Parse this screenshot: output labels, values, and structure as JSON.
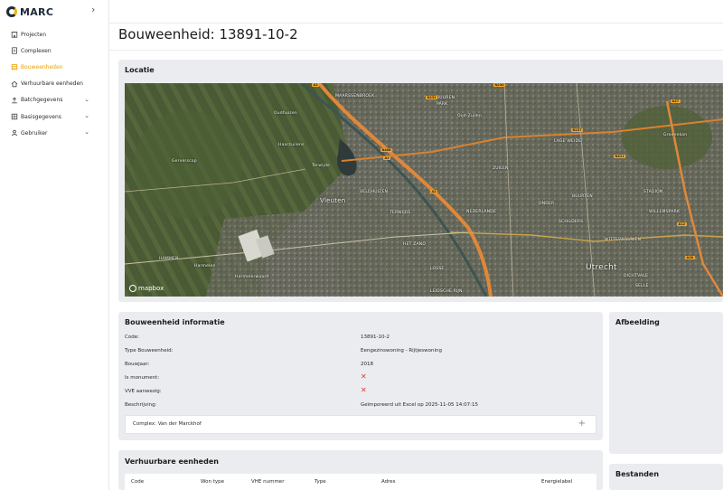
{
  "brand": {
    "name": "MARC",
    "collapse_icon": "chevron-right-icon"
  },
  "sidebar": {
    "items": [
      {
        "label": "Projecten",
        "icon": "building-icon",
        "expandable": false,
        "active": false
      },
      {
        "label": "Complexen",
        "icon": "document-icon",
        "expandable": false,
        "active": false
      },
      {
        "label": "Bouweenheden",
        "icon": "stack-icon",
        "expandable": false,
        "active": true
      },
      {
        "label": "Verhuurbare eenheden",
        "icon": "home-icon",
        "expandable": false,
        "active": false
      },
      {
        "label": "Batchgegevens",
        "icon": "upload-icon",
        "expandable": true,
        "active": false
      },
      {
        "label": "Basisgegevens",
        "icon": "grid-icon",
        "expandable": true,
        "active": false
      },
      {
        "label": "Gebruiker",
        "icon": "user-icon",
        "expandable": true,
        "active": false
      }
    ],
    "active_color": "#e6a100"
  },
  "page": {
    "title": "Bouweenheid: 13891-10-2"
  },
  "locatie": {
    "title": "Locatie",
    "map_attribution": "mapbox",
    "map_labels": [
      "MAARSSENBROEK",
      "BUUREN",
      "PARK",
      "Oud-Zuilen",
      "Oudhuizen",
      "Haarzuilens",
      "Terwijde",
      "ZUILEN",
      "LAGE WEIDE",
      "Gerverscop",
      "Vleuten",
      "VELDHUIZEN",
      "TERWIJDE",
      "NEDERLANDE",
      "ONDER",
      "SCHILDERS",
      "BUURTEN",
      "WITTEVROUWEN",
      "Utrecht",
      "DICHTVALE",
      "SELLE",
      "HAMMEN",
      "Harmelen",
      "Harmelerwaard",
      "HET ZAND",
      "LOSSE",
      "LEIDSCHE RIJN",
      "Groenekan",
      "WILLEMSPARK",
      "STADION"
    ],
    "road_shields": [
      "A2",
      "N230",
      "N231",
      "N408",
      "A2",
      "A27",
      "A28",
      "A12",
      "N237",
      "N411",
      "A2"
    ]
  },
  "info": {
    "title": "Bouweenheid informatie",
    "rows": [
      {
        "label": "Code:",
        "value": "13891-10-2"
      },
      {
        "label": "Type Bouweenheid:",
        "value": "Eengezinswoning - Rijtjeswoning"
      },
      {
        "label": "Bouwjaar:",
        "value": "2018"
      },
      {
        "label": "Is monument:",
        "value": "✕"
      },
      {
        "label": "VVE aanwezig:",
        "value": "✕"
      },
      {
        "label": "Beschrijving:",
        "value": "Geïmporeerd uit Excel op 2025-11-05 14:07:15"
      }
    ],
    "complex_label": "Complex: Van der Marckhof",
    "complex_expand_icon": "plus-icon",
    "false_color": "#e53935"
  },
  "afbeelding": {
    "title": "Afbeelding"
  },
  "bestanden": {
    "title": "Bestanden"
  },
  "vhe": {
    "title": "Verhuurbare eenheden",
    "columns": [
      "Code",
      "Won type",
      "VHE nummer",
      "Type",
      "Adres",
      "Energielabel"
    ]
  }
}
